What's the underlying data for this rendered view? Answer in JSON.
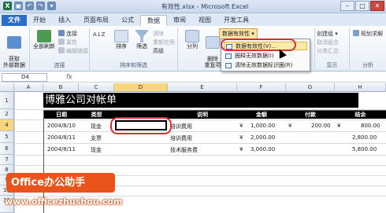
{
  "window": {
    "title": "有效性.xlsx - Microsoft Excel",
    "minimize": "–",
    "restore": "□",
    "close": "✕"
  },
  "tabs": [
    "文件",
    "开始",
    "插入",
    "页面布局",
    "公式",
    "数据",
    "审阅",
    "视图",
    "开发工具"
  ],
  "ribbon": {
    "get_external": "获取\n外部数据",
    "refresh_all": "全部刷新",
    "connections": "连接",
    "properties": "属性",
    "edit_links": "编辑链接",
    "connections_group": "连接",
    "sort_az": "A↓Z",
    "sort": "排序",
    "filter": "筛选",
    "clear": "清除",
    "reapply": "重新应用",
    "advanced": "高级",
    "sort_filter_group": "排序和筛选",
    "text_to_columns": "分列",
    "remove_duplicates": "删除\n重复项",
    "data_validation": "数据有效性",
    "group": "创建组",
    "ungroup": "取消组合",
    "subtotal": "分类汇总",
    "outline_group": "显示",
    "solver": "规划求解",
    "analysis_group": "分析"
  },
  "menu": {
    "items": [
      "数据有效性(V)...",
      "圈释无效数据(I)",
      "清除无效数据标识圈(R)"
    ]
  },
  "formula_bar": {
    "name_box": "D4",
    "fx": "fx"
  },
  "columns": [
    "A",
    "B",
    "C",
    "D",
    "E",
    "F",
    "G",
    "H"
  ],
  "rows": [
    "1",
    "2",
    "3",
    "4",
    "5",
    "6",
    "7",
    "8",
    "9",
    "10",
    "11"
  ],
  "sheet": {
    "banner": "博雅公司对帐单",
    "headers": [
      "日期",
      "类型",
      "",
      "说明",
      "金额",
      "付款",
      "结余"
    ],
    "row4": {
      "date": "2004/8/10",
      "type": "现金",
      "desc": "培训费用",
      "cur1": "¥",
      "amount": "1,000.00",
      "cur2": "¥",
      "pay": "200.00",
      "cur3": "¥",
      "balance": "800.00"
    },
    "row5": {
      "date": "2004/8/11",
      "type": "支票",
      "desc": "培训费用",
      "cur1": "¥",
      "amount": "2,000.00",
      "balance": "2,800.00"
    },
    "row6": {
      "date": "2004/8/11",
      "type": "现金",
      "desc": "技术服务费",
      "cur1": "¥",
      "amount": "3,000.00",
      "balance": "5,800.00"
    }
  },
  "brand": {
    "logo_text": "Office办公助手",
    "url": "www.officezhushou.com"
  }
}
